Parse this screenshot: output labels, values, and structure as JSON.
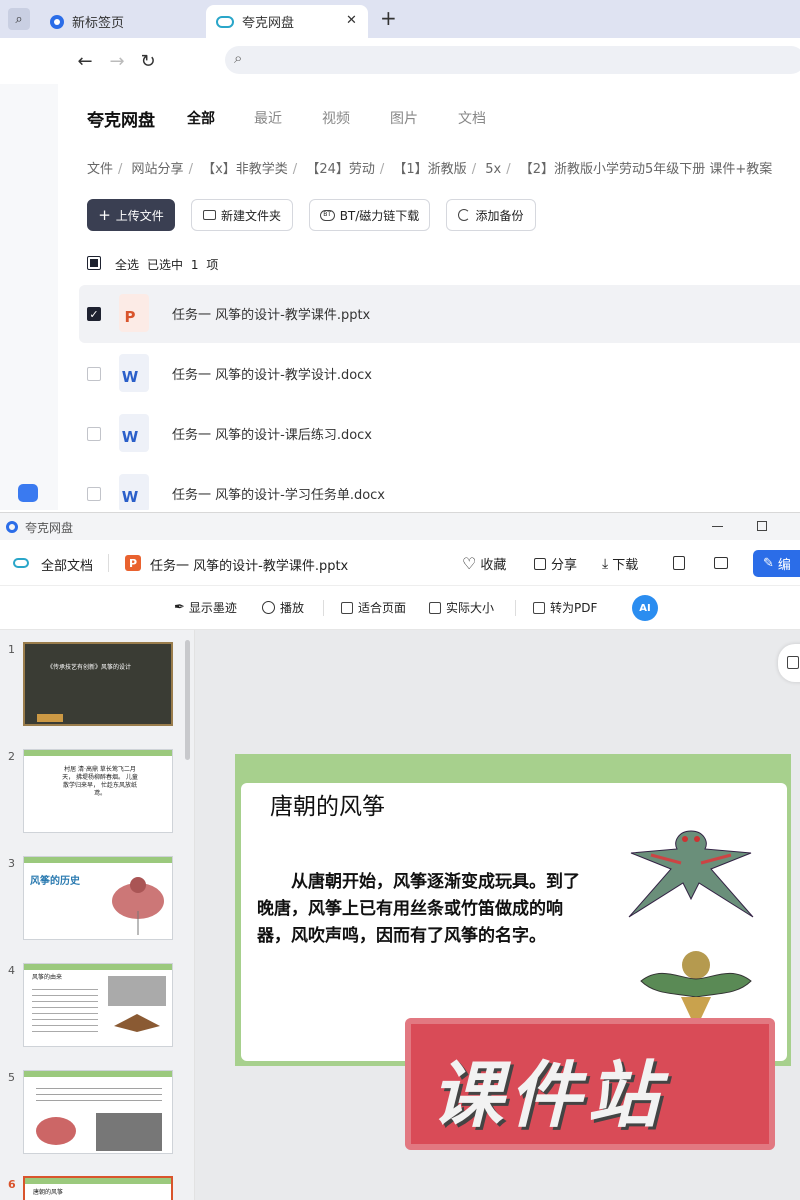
{
  "browser": {
    "tabs": [
      {
        "label": "新标签页"
      },
      {
        "label": "夸克网盘"
      }
    ],
    "close_glyph": "✕",
    "new_tab_glyph": "+"
  },
  "drive": {
    "brand": "夸克网盘",
    "nav": [
      "全部",
      "最近",
      "视频",
      "图片",
      "文档"
    ],
    "breadcrumb": [
      "文件",
      "网站分享",
      "【x】非教学类",
      "【24】劳动",
      "【1】浙教版",
      "5x",
      "【2】浙教版小学劳动5年级下册 课件+教案"
    ],
    "actions": {
      "upload": "上传文件",
      "new_folder": "新建文件夹",
      "bt": "BT/磁力链下载",
      "backup": "添加备份"
    },
    "select_all": "全选",
    "selected_label": "已选中",
    "selected_count": "1",
    "selected_unit": "项",
    "files": [
      {
        "name": "任务一 风筝的设计-教学课件.pptx",
        "type": "pptx",
        "badge": "P",
        "checked": true
      },
      {
        "name": "任务一 风筝的设计-教学设计.docx",
        "type": "docx",
        "badge": "W",
        "checked": false
      },
      {
        "name": "任务一 风筝的设计-课后练习.docx",
        "type": "docx",
        "badge": "W",
        "checked": false
      },
      {
        "name": "任务一 风筝的设计-学习任务单.docx",
        "type": "docx",
        "badge": "W",
        "checked": false
      }
    ]
  },
  "viewer": {
    "window_title": "夸克网盘",
    "all_docs": "全部文档",
    "file_badge": "P",
    "file_name": "任务一 风筝的设计-教学课件.pptx",
    "actions": {
      "favorite": "收藏",
      "share": "分享",
      "download": "下载",
      "edit": "编"
    },
    "toolbar": {
      "ink": "显示墨迹",
      "play": "播放",
      "fit": "适合页面",
      "actual": "实际大小",
      "pdf": "转为PDF",
      "ai": "AI"
    },
    "thumbnails": [
      {
        "num": "1",
        "text": "《传承技艺有创新》风筝的设计"
      },
      {
        "num": "2",
        "text": "村居 清·高鼎 草长莺飞二月天， 拂堤杨柳醉春烟。 儿童散学归来早， 忙趁东风放纸鸢。"
      },
      {
        "num": "3",
        "text": "风筝的历史"
      },
      {
        "num": "4",
        "text": "风筝的由来"
      },
      {
        "num": "5",
        "text": ""
      },
      {
        "num": "6",
        "text": "唐朝的风筝"
      }
    ],
    "slide": {
      "title": "唐朝的风筝",
      "body": "从唐朝开始，风筝逐渐变成玩具。到了晚唐，风筝上已有用丝条或竹笛做成的响器，风吹声鸣，因而有了风筝的名字。"
    },
    "watermark": "课件站"
  }
}
